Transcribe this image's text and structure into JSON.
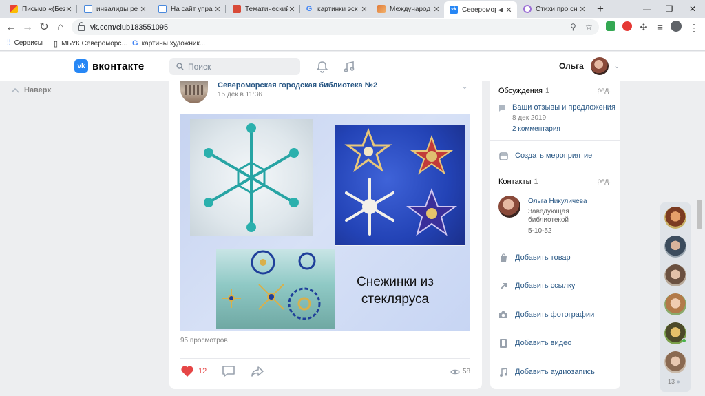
{
  "browser": {
    "tabs": [
      {
        "title": "Письмо «(Без",
        "icon": "gmail-icon",
        "color": "#ea4335"
      },
      {
        "title": "инвалиды ре",
        "icon": "doc-icon",
        "color": "#4a89dc"
      },
      {
        "title": "На сайт управ",
        "icon": "doc-icon",
        "color": "#4a89dc"
      },
      {
        "title": "Тематический",
        "icon": "site-icon",
        "color": "#d84a38"
      },
      {
        "title": "картинки эск",
        "icon": "google-icon",
        "color": "#4285f4"
      },
      {
        "title": "Международ",
        "icon": "site-icon",
        "color": "#e07b39"
      },
      {
        "title": "Североморск",
        "icon": "vk-icon",
        "color": "#2787f5",
        "active": true
      },
      {
        "title": "Стихи про сне",
        "icon": "site-icon",
        "color": "#9c6fd6"
      }
    ],
    "url": "vk.com/club183551095",
    "bookmarks": [
      {
        "label": "Сервисы",
        "icon": "apps-grid-icon"
      },
      {
        "label": "МБУК Североморс...",
        "icon": "book-icon"
      },
      {
        "label": "картины художник...",
        "icon": "google-icon"
      }
    ]
  },
  "vk": {
    "logo_text": "вконтакте",
    "search_placeholder": "Поиск",
    "user_name": "Ольга",
    "back_to_top": "Наверх"
  },
  "post": {
    "author": "Североморская городская библиотека №2",
    "date": "15 дек в 11:36",
    "image_caption_line1": "Снежинки из",
    "image_caption_line2": "стекляруса",
    "views_text": "95 просмотров",
    "likes": "12",
    "view_count": "58"
  },
  "sidebar": {
    "discussions_title": "Обсуждения",
    "discussions_count": "1",
    "edit_label": "ред.",
    "discussion_topic": "Ваши отзывы и предложения",
    "discussion_date": "8 дек 2019",
    "discussion_comments": "2 комментария",
    "create_event": "Создать мероприятие",
    "contacts_title": "Контакты",
    "contacts_count": "1",
    "contact_name": "Ольга Никуличева",
    "contact_role_line1": "Заведующая",
    "contact_role_line2": "библиотекой",
    "contact_phone": "5-10-52",
    "actions": [
      {
        "label": "Добавить товар",
        "icon": "bag-icon"
      },
      {
        "label": "Добавить ссылку",
        "icon": "link-arrow-icon"
      },
      {
        "label": "Добавить фотографии",
        "icon": "camera-icon"
      },
      {
        "label": "Добавить видео",
        "icon": "film-icon"
      },
      {
        "label": "Добавить аудиозапись",
        "icon": "music-note-icon"
      }
    ]
  },
  "friends": {
    "count": "13"
  },
  "colors": {
    "vk_blue": "#2787f5",
    "link": "#2a5885",
    "like_red": "#e64646",
    "page_bg": "#edeef0"
  }
}
